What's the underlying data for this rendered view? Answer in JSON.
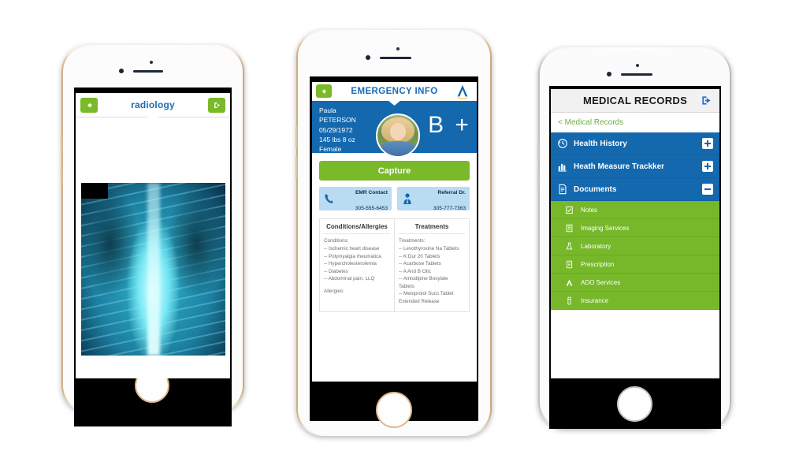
{
  "colors": {
    "green": "#76b82a",
    "button_green": "#7ab929",
    "blue": "#1368ae",
    "title_blue": "#1b6bb5",
    "contact_blue": "#b9dcf3",
    "header_gray": "#f1f1f1"
  },
  "phone1": {
    "device": "iphone-gold",
    "header": {
      "back_icon": "arrow-left-icon",
      "title": "radiology",
      "logout_icon": "logout-icon"
    },
    "content": {
      "image_name": "chest-xray-image"
    }
  },
  "phone2": {
    "device": "iphone-gold",
    "header": {
      "back_icon": "arrow-left-icon",
      "title": "EMERGENCY INFO",
      "logo_icon": "aetna-a-logo-icon"
    },
    "patient": {
      "name": "Paula PETERSON",
      "dob": "05/29/1972",
      "weight": "145 lbs 8 oz",
      "gender": "Female",
      "photo_name": "patient-avatar",
      "blood_type": "B +"
    },
    "capture_label": "Capture",
    "contacts": [
      {
        "icon": "phone-icon",
        "name": "EMR Contact",
        "number": "305-555-6453"
      },
      {
        "icon": "doctor-icon",
        "name": "Referral Dr.",
        "number": "305-777-7363"
      }
    ],
    "conditions_panel": {
      "heading": "Conditions/Allergies",
      "conditions_label": "Conditions:",
      "conditions": [
        "-- Ischemic heart disease",
        "-- Polymyalgia rheumatica",
        "-- Hypercholesterolemia",
        "-- Diabetes",
        "-- Abdominal pain, LLQ"
      ],
      "allergies_label": "Allergies:"
    },
    "treatments_panel": {
      "heading": "Treatments",
      "treatments_label": "Treatments:",
      "treatments": [
        "-- Levothyroxine  Na Tablets",
        "-- K  Dur  20  Tablets",
        "-- Acarbose  Tablets",
        "-- A  And  B  Otic",
        "-- Amlodipine  Bosylate Tablets",
        "-- Metoprolol  Succ Tablet  Extended Release"
      ]
    }
  },
  "phone3": {
    "device": "iphone-silver",
    "header": {
      "title": "MEDICAL RECORDS",
      "logout_icon": "logout-icon"
    },
    "breadcrumb": "< Medical Records",
    "accordion": [
      {
        "icon": "history-clock-icon",
        "label": "Health History",
        "state": "plus"
      },
      {
        "icon": "bar-chart-icon",
        "label": "Heath Measure Trackker",
        "state": "plus"
      },
      {
        "icon": "document-icon",
        "label": "Documents",
        "state": "minus"
      }
    ],
    "documents_submenu": [
      {
        "icon": "notes-icon",
        "label": "Notes"
      },
      {
        "icon": "imaging-icon",
        "label": "Imaging Services"
      },
      {
        "icon": "lab-flask-icon",
        "label": "Laboratory"
      },
      {
        "icon": "prescription-icon",
        "label": "Prescription"
      },
      {
        "icon": "ado-icon",
        "label": "ADO Services"
      },
      {
        "icon": "insurance-icon",
        "label": "Insurance"
      }
    ]
  }
}
